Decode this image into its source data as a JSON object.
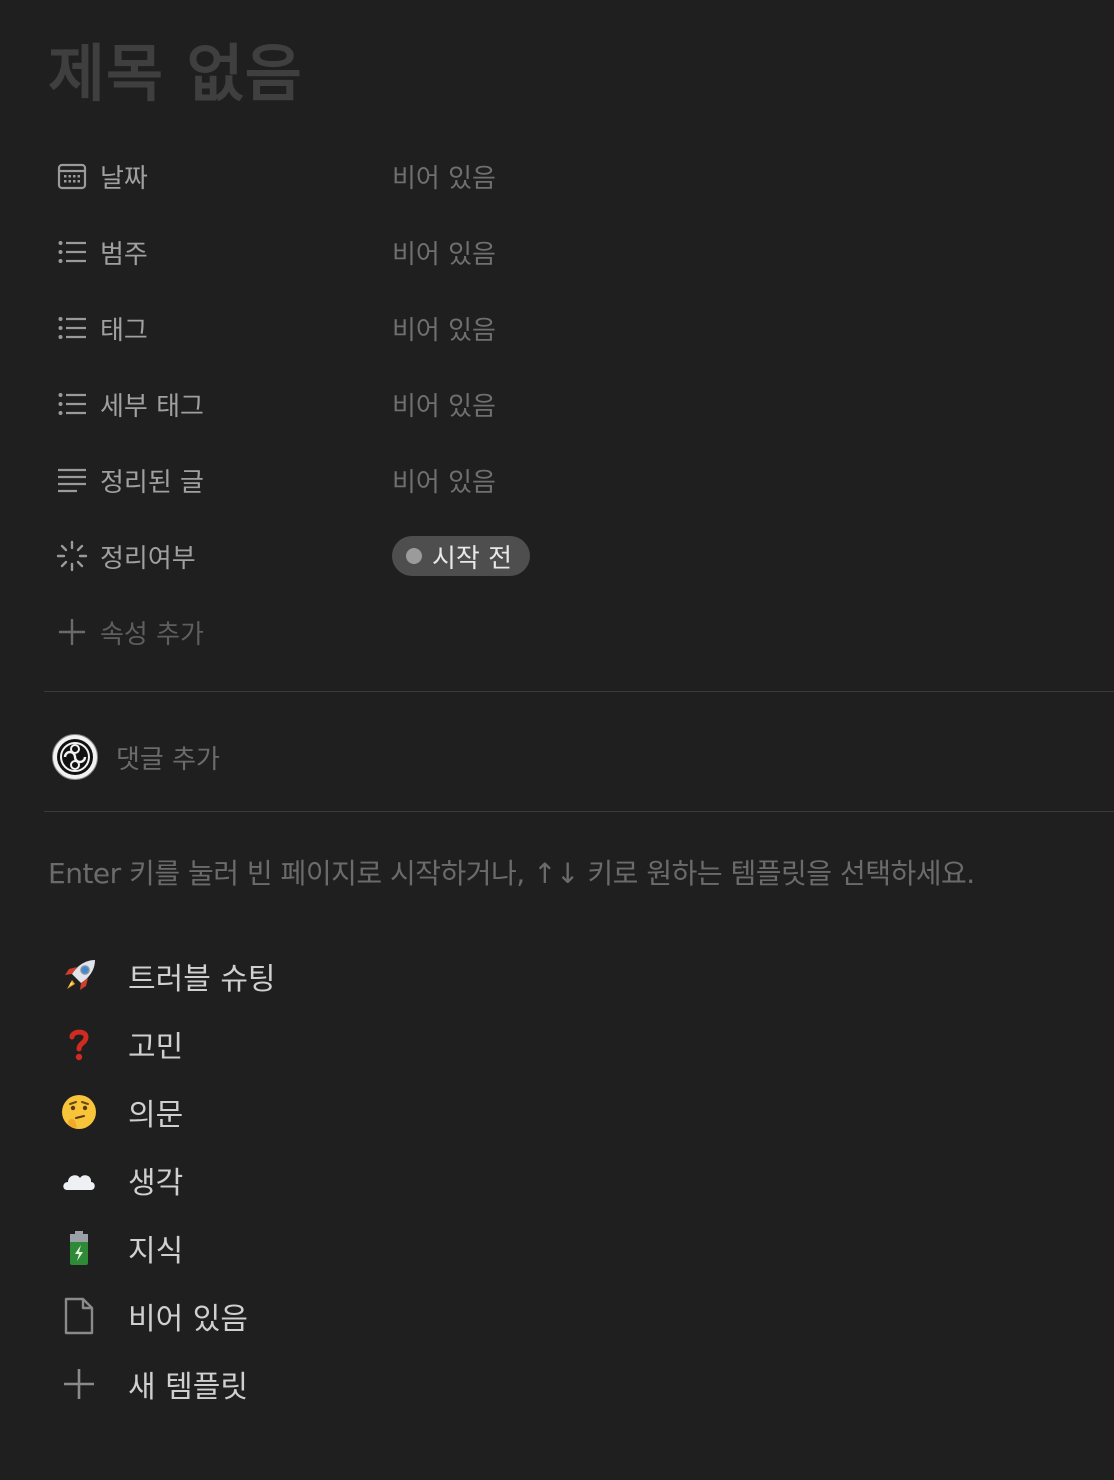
{
  "page": {
    "title": "제목 없음"
  },
  "properties": [
    {
      "name": "날짜",
      "icon": "calendar-icon",
      "value": "비어 있음"
    },
    {
      "name": "범주",
      "icon": "multi-select-list-icon",
      "value": "비어 있음"
    },
    {
      "name": "태그",
      "icon": "multi-select-list-icon",
      "value": "비어 있음"
    },
    {
      "name": "세부 태그",
      "icon": "multi-select-list-icon",
      "value": "비어 있음"
    },
    {
      "name": "정리된 글",
      "icon": "text-lines-icon",
      "value": "비어 있음"
    },
    {
      "name": "정리여부",
      "icon": "status-icon",
      "status": "시작 전"
    }
  ],
  "add_property": {
    "label": "속성 추가",
    "icon": "plus-icon"
  },
  "comment": {
    "placeholder": "댓글 추가",
    "avatar_icon": "avatar-icon"
  },
  "hint": "Enter 키를 눌러 빈 페이지로 시작하거나, ↑↓ 키로 원하는 템플릿을 선택하세요.",
  "templates": [
    {
      "emoji": "🚀",
      "icon": "rocket-icon",
      "label": "트러블 슈팅"
    },
    {
      "emoji": "❓",
      "icon": "question-mark-icon",
      "label": "고민"
    },
    {
      "emoji": "🤔",
      "icon": "thinking-face-icon",
      "label": "의문"
    },
    {
      "emoji": "☁️",
      "icon": "cloud-icon",
      "label": "생각"
    },
    {
      "emoji": "🔋",
      "icon": "battery-icon",
      "label": "지식"
    },
    {
      "icon": "blank-page-icon",
      "label": "비어 있음"
    },
    {
      "icon": "plus-icon",
      "label": "새 템플릿"
    }
  ],
  "colors": {
    "background": "#1f1f1f",
    "title": "#3f3f3f",
    "status_pill": "#4e4e4e"
  }
}
